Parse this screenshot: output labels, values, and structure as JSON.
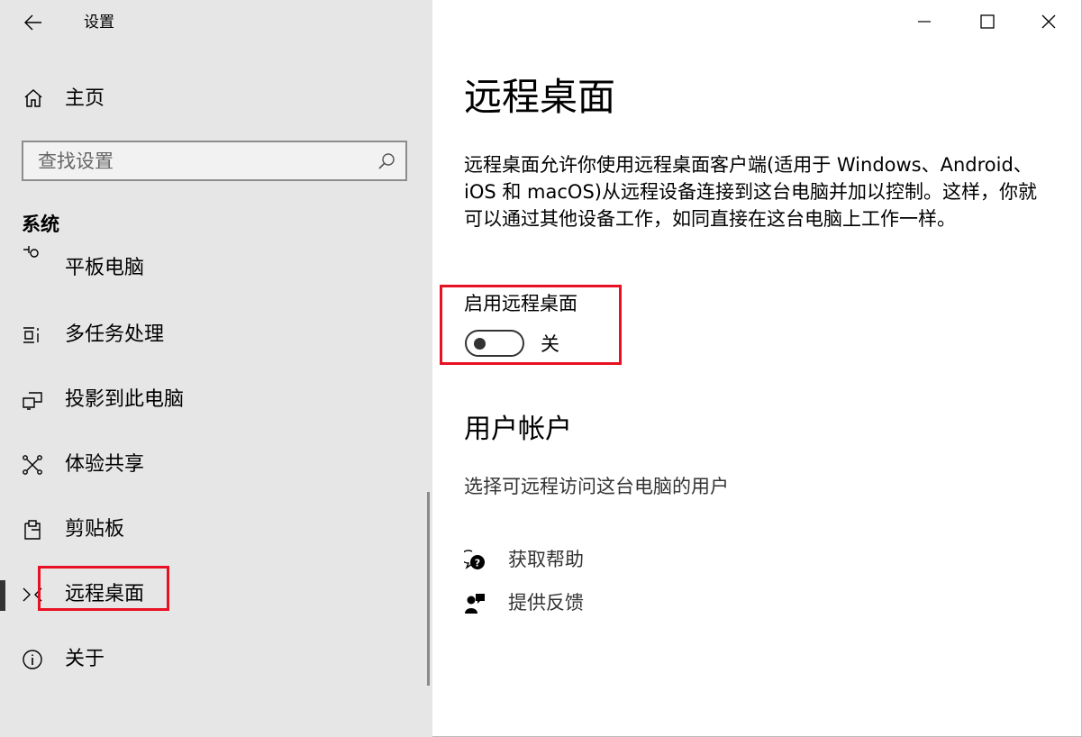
{
  "app": {
    "title": "设置"
  },
  "sidebar": {
    "home_label": "主页",
    "search_placeholder": "查找设置",
    "section_title": "系统",
    "items": [
      {
        "label": "平板电脑",
        "icon": "tablet-icon"
      },
      {
        "label": "多任务处理",
        "icon": "multitasking-icon"
      },
      {
        "label": "投影到此电脑",
        "icon": "projecting-icon"
      },
      {
        "label": "体验共享",
        "icon": "shared-experiences-icon"
      },
      {
        "label": "剪贴板",
        "icon": "clipboard-icon"
      },
      {
        "label": "远程桌面",
        "icon": "remote-desktop-icon",
        "selected": true
      },
      {
        "label": "关于",
        "icon": "info-icon"
      }
    ]
  },
  "main": {
    "title": "远程桌面",
    "description": "远程桌面允许你使用远程桌面客户端(适用于 Windows、Android、iOS 和 macOS)从远程设备连接到这台电脑并加以控制。这样，你就可以通过其他设备工作，如同直接在这台电脑上工作一样。",
    "toggle": {
      "label": "启用远程桌面",
      "state_text": "关",
      "on": false
    },
    "user_accounts": {
      "title": "用户帐户",
      "link": "选择可远程访问这台电脑的用户"
    },
    "help": [
      {
        "label": "获取帮助",
        "icon": "get-help-icon"
      },
      {
        "label": "提供反馈",
        "icon": "feedback-icon"
      }
    ]
  },
  "colors": {
    "sidebar_bg": "#e6e6e6",
    "highlight": "#e81123",
    "text": "#000000"
  }
}
